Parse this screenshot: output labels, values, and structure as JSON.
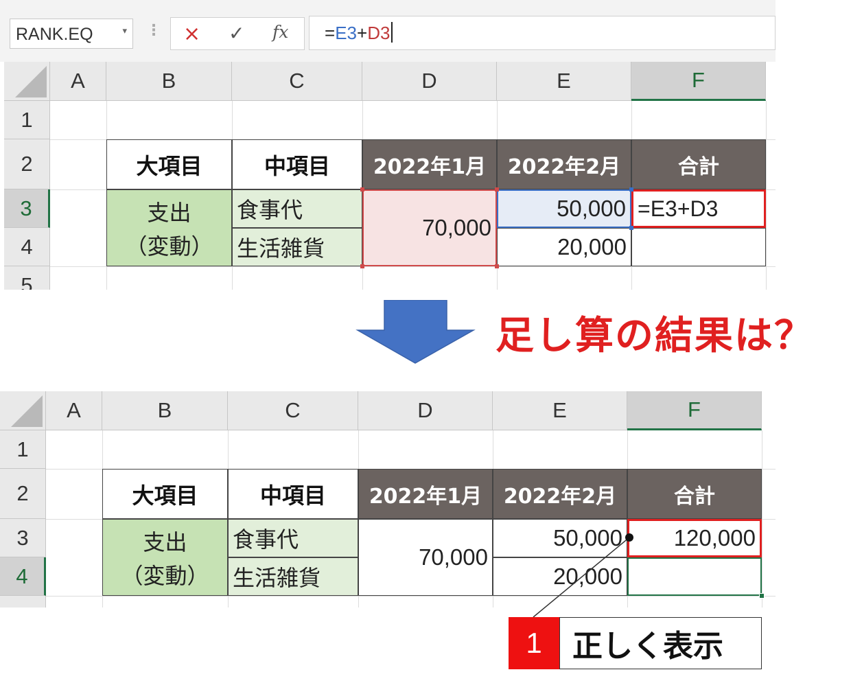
{
  "formula_bar": {
    "name_box": "RANK.EQ",
    "formula_prefix": "=",
    "formula_ref1": "E3",
    "formula_op": "+",
    "formula_ref2": "D3",
    "cancel_icon": "×",
    "enter_icon": "✓",
    "fx_label": "fx"
  },
  "columns": [
    "A",
    "B",
    "C",
    "D",
    "E",
    "F"
  ],
  "rows": [
    "1",
    "2",
    "3",
    "4",
    "5"
  ],
  "table": {
    "header_major": "大項目",
    "header_minor": "中項目",
    "header_jan": "2022年1月",
    "header_feb": "2022年2月",
    "header_total": "合計",
    "category_line1": "支出",
    "category_line2": "（変動）",
    "item_food": "食事代",
    "item_goods": "生活雑貨",
    "jan_value": "70,000",
    "feb_food": "50,000",
    "feb_goods": "20,000"
  },
  "top_grid": {
    "f3_text": "=E3+D3"
  },
  "bottom_grid": {
    "f3_text": "120,000"
  },
  "question_text": "足し算の結果は？",
  "callout": {
    "number": "1",
    "label": "正しく表示"
  },
  "colors": {
    "accent_red": "#e02020",
    "arrow_blue": "#4472c4",
    "header_dark": "#6b6360",
    "green_dark": "#c6e2b4",
    "green_light": "#e2efda",
    "excel_green": "#217346"
  }
}
